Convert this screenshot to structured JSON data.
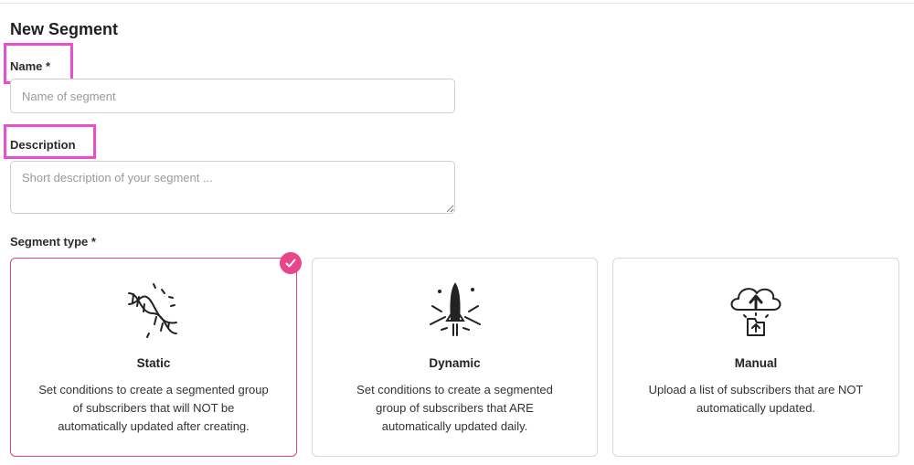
{
  "page": {
    "title": "New Segment"
  },
  "form": {
    "name_label": "Name *",
    "name_placeholder": "Name of segment",
    "description_label": "Description",
    "description_placeholder": "Short description of your segment ...",
    "segment_type_label": "Segment type *"
  },
  "segment_types": [
    {
      "title": "Static",
      "description": "Set conditions to create a segmented group of subscribers that will NOT be automatically updated after creating.",
      "icon": "dna-icon",
      "selected": true
    },
    {
      "title": "Dynamic",
      "description": "Set conditions to create a segmented group of subscribers that ARE automatically updated daily.",
      "icon": "rocket-icon",
      "selected": false
    },
    {
      "title": "Manual",
      "description": "Upload a list of subscribers that are NOT automatically updated.",
      "icon": "cloud-upload-icon",
      "selected": false
    }
  ],
  "colors": {
    "highlight": "#e84fd0",
    "selected_border": "#e0467c",
    "check_badge": "#e8458b"
  }
}
